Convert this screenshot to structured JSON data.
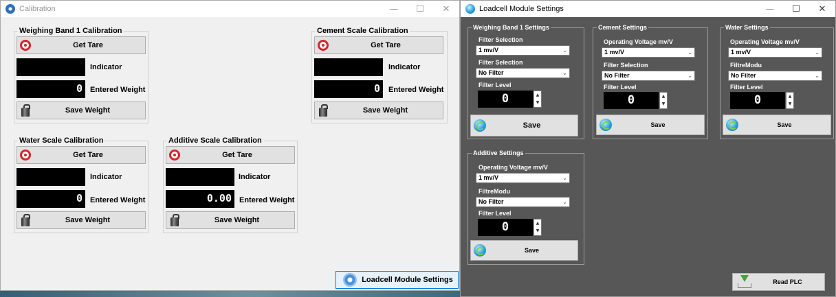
{
  "calibration_window": {
    "title": "Calibration",
    "controls": {
      "minimize": "—",
      "maximize": "☐",
      "close": "✕"
    },
    "weighing_band_1": {
      "title": "Weighing Band 1 Calibration",
      "get_tare": "Get Tare",
      "indicator_label": "Indicator",
      "indicator_value": "",
      "entered_weight_label": "Entered Weight",
      "entered_weight_value": "0",
      "save_weight": "Save Weight"
    },
    "cement_scale": {
      "title": "Cement Scale Calibration",
      "get_tare": "Get Tare",
      "indicator_label": "Indicator",
      "indicator_value": "",
      "entered_weight_label": "Entered Weight",
      "entered_weight_value": "0",
      "save_weight": "Save Weight"
    },
    "water_scale": {
      "title": "Water Scale Calibration",
      "get_tare": "Get Tare",
      "indicator_label": "Indicator",
      "indicator_value": "",
      "entered_weight_label": "Entered Weight",
      "entered_weight_value": "0",
      "save_weight": "Save Weight"
    },
    "additive_scale": {
      "title": "Additive Scale Calibration",
      "get_tare": "Get Tare",
      "indicator_label": "Indicator",
      "indicator_value": "",
      "entered_weight_label": "Entered Weight",
      "entered_weight_value": "0.00",
      "save_weight": "Save Weight"
    },
    "loadcell_button": "Loadcell Module Settings"
  },
  "loadcell_window": {
    "title": "Loadcell Module Settings",
    "controls": {
      "minimize": "—",
      "maximize": "☐",
      "close": "✕"
    },
    "weighing_band": {
      "title": "Weighing Band 1 Settings",
      "field1_label": "Filter Selection",
      "field1_value": "1 mv/V",
      "field2_label": "Filter Selection",
      "field2_value": "No Filter",
      "level_label": "Filter Level",
      "level_value": "0",
      "save": "Save"
    },
    "cement": {
      "title": "Cement Settings",
      "field1_label": "Operating Voltage mv/V",
      "field1_value": "1 mv/V",
      "field2_label": "Filter Selection",
      "field2_value": "No Filter",
      "level_label": "Filter Level",
      "level_value": "0",
      "save": "Save"
    },
    "water": {
      "title": "Water Settings",
      "field1_label": "Operating Voltage mv/V",
      "field1_value": "1 mv/V",
      "field2_label": "FiltreModu",
      "field2_value": "No Filter",
      "level_label": "Filter Level",
      "level_value": "0",
      "save": "Save"
    },
    "additive": {
      "title": "Additive Settings",
      "field1_label": "Operating Voltage mv/V",
      "field1_value": "1 mv/V",
      "field2_label": "FiltreModu",
      "field2_value": "No Filter",
      "level_label": "Filter Level",
      "level_value": "0",
      "save": "Save"
    },
    "read_plc": "Read PLC"
  },
  "colors": {
    "settings_background": "#575757",
    "calibration_background": "#f0f0f0",
    "display_background": "#000000",
    "tare_icon": "#d8232a",
    "active_button_border": "#0078d7"
  }
}
